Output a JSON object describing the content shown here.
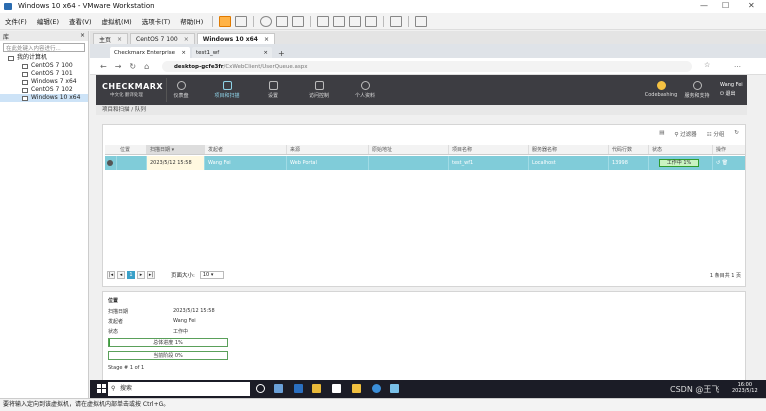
{
  "window": {
    "title": "Windows 10 x64 - VMware Workstation"
  },
  "menu": {
    "items": [
      "文件(F)",
      "编辑(E)",
      "查看(V)",
      "虚拟机(M)",
      "选项卡(T)",
      "帮助(H)"
    ]
  },
  "library": {
    "header": "库",
    "close": "×",
    "search_placeholder": "在此处键入内容进行...",
    "root": "我的计算机",
    "vms": [
      "CentOS 7 100",
      "CentOS 7 101",
      "Windows 7 x64",
      "CentOS 7 102",
      "Windows 10 x64"
    ]
  },
  "vm_tabs": [
    {
      "label": "主页"
    },
    {
      "label": "CentOS 7 100"
    },
    {
      "label": "Windows 10 x64"
    }
  ],
  "browser": {
    "tabs": [
      "Checkmarx Enterprise",
      "test1_wf"
    ],
    "new_tab": "+",
    "url_host": "desktop-gcfe3fr",
    "url_path": "/CxWebClient/UserQueue.aspx"
  },
  "checkmarx": {
    "brand": "CHECKMARX",
    "brand_sub": "中文化 翻译处理",
    "nav": [
      "仪表盘",
      "项目和扫描",
      "设置",
      "访问控制",
      "个人资料"
    ],
    "right_nav": [
      "Codebashing",
      "服务和支持"
    ],
    "user": "Wang Fei",
    "logout": "退出",
    "breadcrumb": "项目和扫描 / 队列"
  },
  "grid": {
    "tools": [
      "过滤器",
      "分组"
    ],
    "columns": [
      "位置",
      "扫描日期",
      "发起者",
      "来源",
      "原始地址",
      "项目名称",
      "服务器名称",
      "代码行数",
      "状态",
      "操作"
    ],
    "row": {
      "date": "2023/5/12 15:58",
      "initiator": "Wang Fei",
      "origin": "Web Portal",
      "origin_url": "",
      "project": "test_wf1",
      "server": "Localhost",
      "loc": "13998",
      "status": "工作中 1%"
    },
    "pager": {
      "current": "1",
      "page_size_label": "页面大小:",
      "page_size": "10",
      "total": "1 条目共 1 页"
    }
  },
  "details": {
    "title": "位置",
    "fields": [
      {
        "label": "扫描日期",
        "value": "2023/5/12 15:58"
      },
      {
        "label": "发起者",
        "value": "Wang Fei"
      },
      {
        "label": "状态",
        "value": "工作中"
      }
    ],
    "overall_progress": "总体进度 1%",
    "overall_fraction": 0.01,
    "current_stage": "当前阶段 0%",
    "current_fraction": 0,
    "stage": "Stage # 1 of 1"
  },
  "taskbar": {
    "search": "搜索",
    "time": "16:00",
    "date": "2023/5/12"
  },
  "statusbar": "要将输入定向到该虚拟机，请在虚拟机内部单击或按 Ctrl+G。",
  "watermark": "CSDN @王飞"
}
